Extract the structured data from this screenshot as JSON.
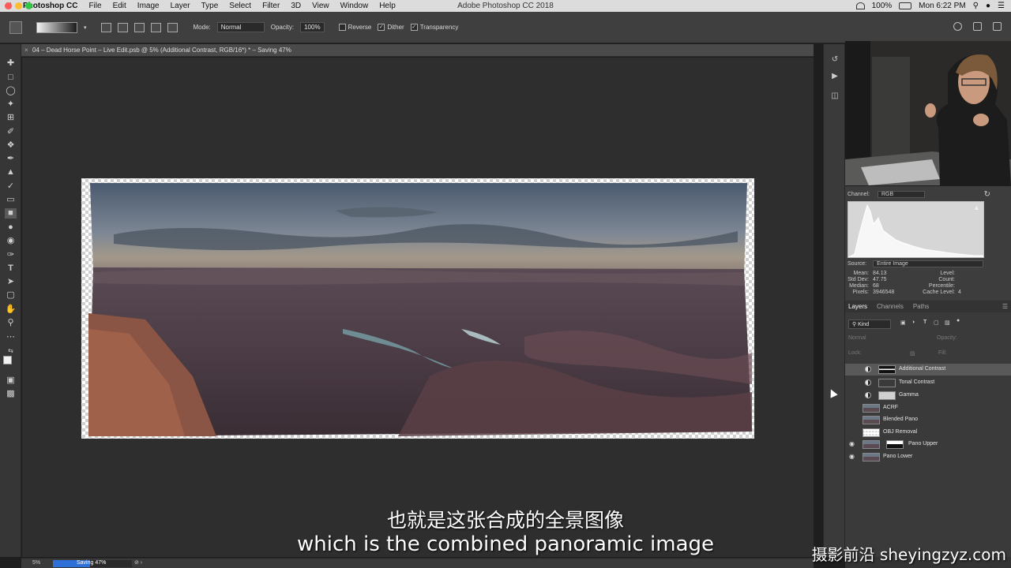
{
  "menubar": {
    "app_name": "Photoshop CC",
    "items": [
      "File",
      "Edit",
      "Image",
      "Layer",
      "Type",
      "Select",
      "Filter",
      "3D",
      "View",
      "Window",
      "Help"
    ],
    "window_title": "Adobe Photoshop CC 2018",
    "battery": "100%",
    "clock": "Mon 6:22 PM"
  },
  "options": {
    "mode_label": "Mode:",
    "mode_value": "Normal",
    "opacity_label": "Opacity:",
    "opacity_value": "100%",
    "reverse_label": "Reverse",
    "dither_label": "Dither",
    "transparency_label": "Transparency"
  },
  "document": {
    "tab_title": "04 – Dead Horse Point – Live Edit.psb @ 5% (Additional Contrast, RGB/16*) * – Saving 47%"
  },
  "histogram": {
    "channel_label": "Channel:",
    "channel_value": "RGB",
    "source_label": "Source:",
    "source_value": "Entire Image",
    "stats_left": [
      {
        "label": "Mean:",
        "value": "84.13"
      },
      {
        "label": "Std Dev:",
        "value": "47.75"
      },
      {
        "label": "Median:",
        "value": "68"
      },
      {
        "label": "Pixels:",
        "value": "3946548"
      }
    ],
    "stats_right": [
      {
        "label": "Level:",
        "value": ""
      },
      {
        "label": "Count:",
        "value": ""
      },
      {
        "label": "Percentile:",
        "value": ""
      },
      {
        "label": "Cache Level:",
        "value": "4"
      }
    ]
  },
  "layers_panel": {
    "tabs": [
      "Layers",
      "Channels",
      "Paths"
    ],
    "filter_label": "Kind",
    "blend_mode": "Normal",
    "opacity_label": "Opacity:",
    "lock_label": "Lock:",
    "fill_label": "Fill:",
    "layers": [
      {
        "name": "Additional Contrast",
        "visible": false,
        "selected": true
      },
      {
        "name": "Tonal Contrast",
        "visible": false,
        "selected": false
      },
      {
        "name": "Gamma",
        "visible": false,
        "selected": false
      },
      {
        "name": "ACRF",
        "visible": false,
        "selected": false
      },
      {
        "name": "Blended Pano",
        "visible": false,
        "selected": false
      },
      {
        "name": "OBJ Removal",
        "visible": false,
        "selected": false
      },
      {
        "name": "Pano Upper",
        "visible": true,
        "selected": false
      },
      {
        "name": "Pano Lower",
        "visible": true,
        "selected": false
      }
    ]
  },
  "status": {
    "zoom": "5%",
    "saving_label": "Saving 47%",
    "saving_progress": 0.47
  },
  "subtitles": {
    "chinese": "也就是这张合成的全景图像",
    "english": "which is the combined panoramic image"
  },
  "watermark": "摄影前沿 sheyingzyz.com",
  "icons": {
    "tools": [
      "move-icon",
      "marquee-icon",
      "lasso-icon",
      "magic-wand-icon",
      "crop-icon",
      "eyedropper-icon",
      "healing-brush-icon",
      "brush-icon",
      "clone-stamp-icon",
      "history-brush-icon",
      "eraser-icon",
      "gradient-icon",
      "blur-icon",
      "dodge-icon",
      "pen-icon",
      "type-icon",
      "path-selection-icon",
      "rectangle-icon",
      "hand-icon",
      "zoom-icon"
    ]
  },
  "colors": {
    "accent": "#2f6fd8"
  }
}
